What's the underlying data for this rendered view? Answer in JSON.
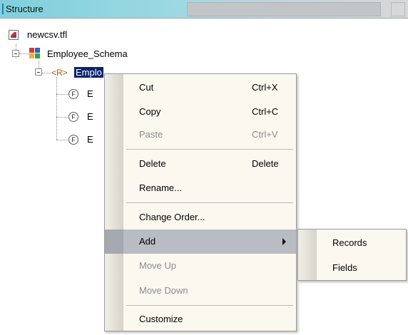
{
  "panel": {
    "title": "Structure"
  },
  "tree": {
    "file": {
      "label": "newcsv.tfl",
      "icon": "tfl-file-icon"
    },
    "schema": {
      "label": "Employee_Schema",
      "icon": "schema-icon"
    },
    "record": {
      "glyph": "<R>",
      "label": "Emplo"
    },
    "fields": [
      {
        "glyph": "F",
        "label": "E"
      },
      {
        "glyph": "F",
        "label": "E"
      },
      {
        "glyph": "F",
        "label": "E"
      }
    ]
  },
  "context_menu": {
    "items": [
      {
        "label": "Cut",
        "shortcut": "Ctrl+X",
        "enabled": true
      },
      {
        "label": "Copy",
        "shortcut": "Ctrl+C",
        "enabled": true
      },
      {
        "label": "Paste",
        "shortcut": "Ctrl+V",
        "enabled": false
      },
      {
        "label": "Delete",
        "shortcut": "Delete",
        "enabled": true
      },
      {
        "label": "Rename...",
        "shortcut": "",
        "enabled": true
      },
      {
        "label": "Change Order...",
        "shortcut": "",
        "enabled": true
      },
      {
        "label": "Add",
        "shortcut": "",
        "enabled": true,
        "submenu": true,
        "highlighted": true
      },
      {
        "label": "Move Up",
        "shortcut": "",
        "enabled": false
      },
      {
        "label": "Move Down",
        "shortcut": "",
        "enabled": false
      },
      {
        "label": "Customize",
        "shortcut": "",
        "enabled": true
      }
    ]
  },
  "submenu": {
    "items": [
      {
        "label": "Records"
      },
      {
        "label": "Fields"
      }
    ]
  },
  "colors": {
    "selection": "#0a246a",
    "menu_background": "#fbf8ef",
    "highlight": "#b9bcc2",
    "disabled_text": "#8c8c8c",
    "record_glyph": "#b3540b"
  }
}
